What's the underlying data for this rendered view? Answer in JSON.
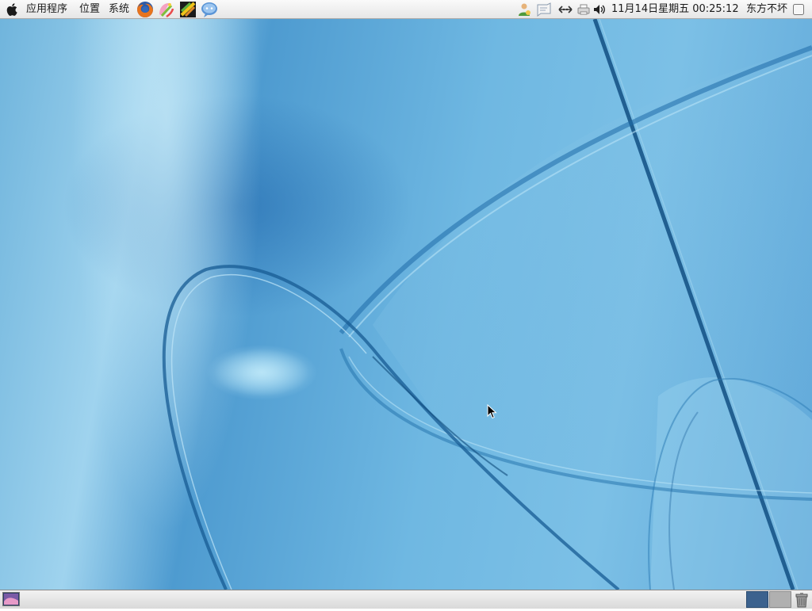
{
  "top_panel": {
    "menus": {
      "applications": "应用程序",
      "places": "位置",
      "system": "系统"
    },
    "launchers": [
      {
        "icon": "firefox-icon"
      },
      {
        "icon": "paint-icon"
      },
      {
        "icon": "photo-gallery-icon"
      },
      {
        "icon": "chat-icon"
      }
    ],
    "tray": {
      "user_icon": "user-icon",
      "chat_icon": "message-icon",
      "network_icon": "network-icon",
      "printer_icon": "printer-icon",
      "volume_icon": "volume-icon"
    },
    "clock": "11月14日星期五 00:25:12",
    "user_name": "东方不坏"
  },
  "bottom_panel": {
    "show_desktop_icon": "show-desktop-icon",
    "workspaces": [
      {
        "name": "workspace-1",
        "active": true,
        "color": "#3c628e"
      },
      {
        "name": "workspace-2",
        "active": false,
        "color": "#b0b0b0"
      }
    ],
    "trash_icon": "trash-icon"
  },
  "colors": {
    "panel_bg": "#ececec",
    "wallpaper_blue": "#5ea6d8",
    "workspace_active": "#3c628e"
  }
}
